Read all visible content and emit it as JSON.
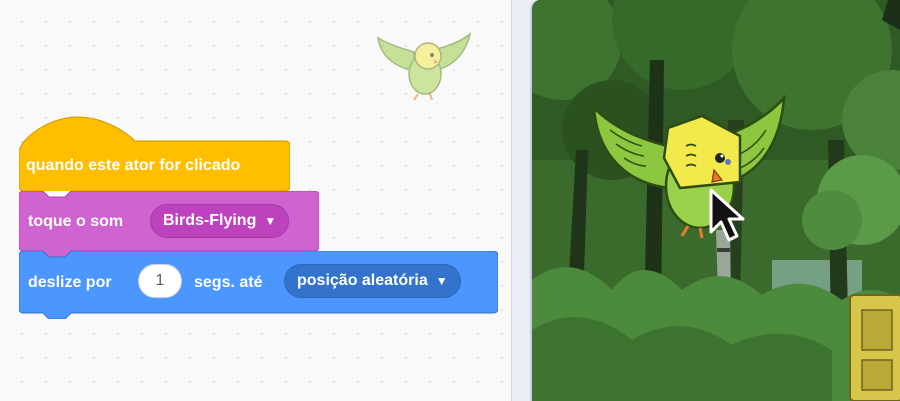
{
  "script_area": {
    "blocks": {
      "hat": {
        "label": "quando este ator for clicado",
        "color": "#ffbf00"
      },
      "sound": {
        "label": "toque o som",
        "dropdown_value": "Birds-Flying",
        "color": "#cf63cf"
      },
      "motion": {
        "label_1": "deslize por",
        "seconds_value": "1",
        "label_2": "segs. até",
        "dropdown_value": "posição aleatória",
        "color": "#4c97ff"
      }
    },
    "sprite_thumbnail_icon": "parakeet-icon"
  },
  "stage": {
    "backdrop_icon": "forest-icon",
    "sprite_icon": "parakeet-icon",
    "cursor_icon": "mouse-pointer-icon"
  }
}
